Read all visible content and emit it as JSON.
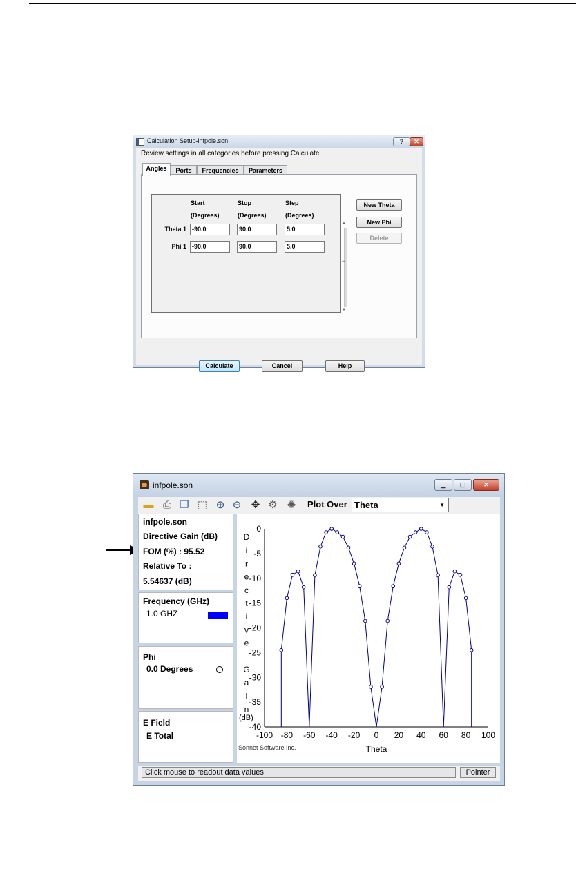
{
  "dialog": {
    "title": "Calculation Setup-infpole.son",
    "help_btn": "?",
    "close_btn": "✕",
    "review_text": "Review settings in all categories before pressing Calculate",
    "tabs": [
      "Angles",
      "Ports",
      "Frequencies",
      "Parameters"
    ],
    "headers": {
      "start": "Start",
      "stop": "Stop",
      "step": "Step",
      "start_unit": "(Degrees)",
      "stop_unit": "(Degrees)",
      "step_unit": "(Degrees)"
    },
    "rows": [
      {
        "label": "Theta 1",
        "start": "-90.0",
        "stop": "90.0",
        "step": "5.0"
      },
      {
        "label": "Phi 1",
        "start": "-90.0",
        "stop": "90.0",
        "step": "5.0"
      }
    ],
    "side_buttons": {
      "new_theta": "New Theta",
      "new_phi": "New Phi",
      "delete": "Delete"
    },
    "buttons": {
      "calculate": "Calculate",
      "cancel": "Cancel",
      "help": "Help"
    }
  },
  "window": {
    "title": "infpole.son",
    "plot_over_label": "Plot Over",
    "plot_over_value": "Theta",
    "info": {
      "file": "infpole.son",
      "quantity": "Directive Gain (dB)",
      "fom": "FOM (%) : 95.52",
      "relative_label": "Relative To :",
      "relative_value": "5.54637 (dB)"
    },
    "frequency": {
      "title": "Frequency (GHz)",
      "item": "1.0 GHZ",
      "color": "#0000ff"
    },
    "phi": {
      "title": "Phi",
      "item": "0.0 Degrees"
    },
    "efield": {
      "title": "E Field",
      "item": "E Total"
    },
    "status_text": "Click mouse to readout data values",
    "pointer_text": "Pointer",
    "credit": "Sonnet Software Inc.",
    "toolbar_icons": [
      "open-icon",
      "print-icon",
      "copy-icon",
      "select-icon",
      "zoom-in-icon",
      "zoom-out-icon",
      "pan-icon",
      "settings-icon",
      "gear-icon"
    ]
  },
  "chart_data": {
    "type": "line",
    "xlabel": "Theta",
    "ylabel_letters": [
      "D",
      "i",
      "r",
      "e",
      "c",
      "t",
      "i",
      "v",
      "e",
      "",
      "G",
      "a",
      "i",
      "n"
    ],
    "ylabel_unit": "(dB)",
    "xlim": [
      -100,
      100
    ],
    "ylim": [
      -40,
      0
    ],
    "xticks": [
      -100,
      -80,
      -60,
      -40,
      -20,
      0,
      20,
      40,
      60,
      80,
      100
    ],
    "yticks": [
      0,
      -5,
      -10,
      -15,
      -20,
      -25,
      -30,
      -35,
      -40
    ],
    "line_color": "#00008b",
    "marker": "circle",
    "series": [
      {
        "x": [
          -85,
          -80,
          -75,
          -70,
          -65,
          -60,
          -55,
          -50,
          -45,
          -40,
          -35,
          -30,
          -25,
          -20,
          -15,
          -10,
          -5,
          0,
          5,
          10,
          15,
          20,
          25,
          30,
          35,
          40,
          45,
          50,
          55,
          60,
          65,
          70,
          75,
          80,
          85
        ],
        "y": [
          -24.5,
          -14,
          -9.3,
          -8.6,
          -11.8,
          -40,
          -9.4,
          -3.6,
          -0.7,
          0,
          -0.7,
          -1.6,
          -3.8,
          -7,
          -11.6,
          -18.6,
          -31.9,
          -40,
          -31.9,
          -18.6,
          -11.6,
          -7,
          -3.8,
          -1.6,
          -0.7,
          0,
          -0.7,
          -3.6,
          -9.4,
          -40,
          -11.8,
          -8.6,
          -9.3,
          -14,
          -24.5
        ]
      }
    ]
  }
}
